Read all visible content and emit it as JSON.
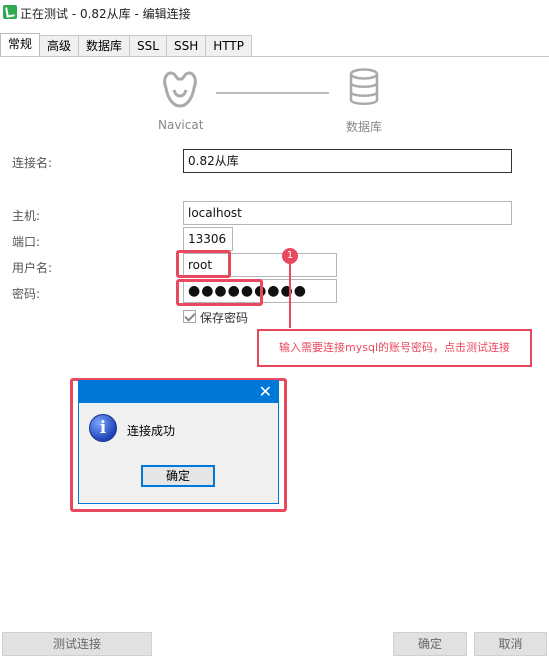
{
  "window": {
    "title": "正在测试 - 0.82从库 - 编辑连接"
  },
  "tabs": [
    {
      "label": "常规",
      "active": true
    },
    {
      "label": "高级"
    },
    {
      "label": "数据库"
    },
    {
      "label": "SSL"
    },
    {
      "label": "SSH"
    },
    {
      "label": "HTTP"
    }
  ],
  "header": {
    "left_label": "Navicat",
    "right_label": "数据库"
  },
  "form": {
    "connection_name": {
      "label": "连接名:",
      "value": "0.82从库"
    },
    "host": {
      "label": "主机:",
      "value": "localhost"
    },
    "port": {
      "label": "端口:",
      "value": "13306"
    },
    "username": {
      "label": "用户名:",
      "value": "root"
    },
    "password": {
      "label": "密码:",
      "value": "●●●●●●●●●"
    },
    "save_password": {
      "label": "保存密码",
      "checked": true
    }
  },
  "annotation": {
    "marker": "1",
    "callout": "输入需要连接mysql的账号密码，点击测试连接",
    "color": "#e8495f"
  },
  "dialog": {
    "message": "连接成功",
    "ok_label": "确定",
    "close_glyph": "✕"
  },
  "footer": {
    "test_label": "测试连接",
    "ok_label": "确定",
    "cancel_label": "取消"
  }
}
